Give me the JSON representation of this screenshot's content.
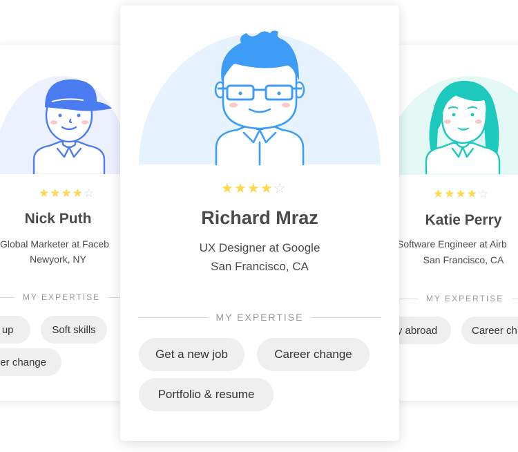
{
  "cards": {
    "left": {
      "name": "Nick Puth",
      "role": "Global Marketer at Faceb",
      "location": "Newyork, NY",
      "rating": 4,
      "rating_max": 5,
      "expertise_label": "MY EXPERTISE",
      "tags": [
        "t up",
        "Soft skills",
        "eer change"
      ],
      "arc_color": "#ecf0ff",
      "avatar_color": "#4a7bf0"
    },
    "center": {
      "name": "Richard Mraz",
      "role": "UX Designer at Google",
      "location": "San Francisco, CA",
      "rating": 4,
      "rating_max": 5,
      "expertise_label": "MY EXPERTISE",
      "tags": [
        "Get a new job",
        "Career change",
        "Portfolio & resume"
      ],
      "arc_color": "#e7f2ff",
      "avatar_color": "#3d9cf5"
    },
    "right": {
      "name": "Katie Perry",
      "role": "Software Engineer at Airb",
      "location": "San Francisco, CA",
      "rating": 4,
      "rating_max": 5,
      "expertise_label": "MY EXPERTISE",
      "tags": [
        "y abroad",
        "Career ch"
      ],
      "arc_color": "#e4f8f6",
      "avatar_color": "#1dc9bd"
    }
  },
  "icons": {
    "star_filled": "star-filled-icon",
    "star_empty": "star-empty-icon"
  },
  "colors": {
    "star": "#ffd84d",
    "star_empty": "#d6d6d6",
    "pill_bg": "#efefef"
  }
}
